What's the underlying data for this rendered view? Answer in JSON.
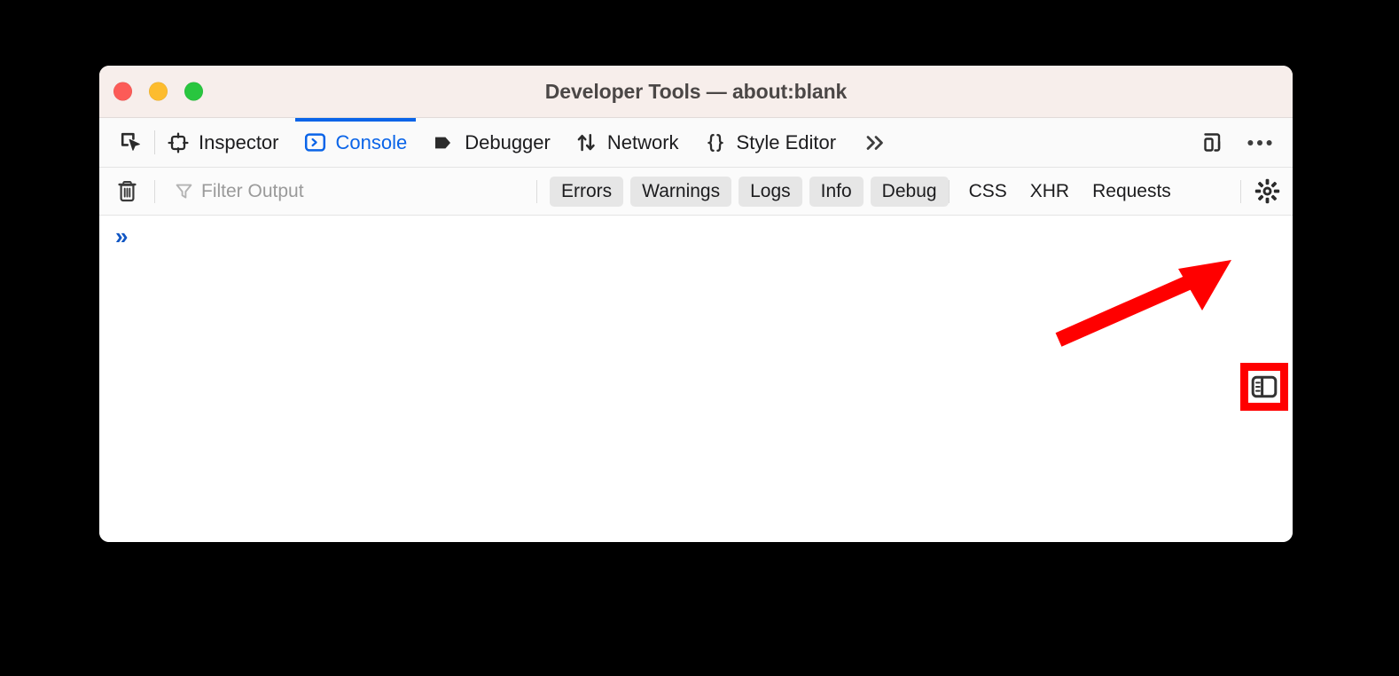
{
  "window": {
    "title": "Developer Tools — about:blank",
    "traffic_lights": [
      {
        "name": "close",
        "color": "#fc5b57"
      },
      {
        "name": "minimize",
        "color": "#fdbc2e"
      },
      {
        "name": "maximize",
        "color": "#29c63f"
      }
    ]
  },
  "toolbar": {
    "picker_icon": "element-picker-icon",
    "tabs": [
      {
        "label": "Inspector",
        "icon": "inspector-icon",
        "active": false
      },
      {
        "label": "Console",
        "icon": "console-icon",
        "active": true
      },
      {
        "label": "Debugger",
        "icon": "debugger-icon",
        "active": false
      },
      {
        "label": "Network",
        "icon": "network-icon",
        "active": false
      },
      {
        "label": "Style Editor",
        "icon": "style-editor-icon",
        "active": false
      }
    ],
    "overflow_label": "»",
    "responsive_mode_icon": "responsive-design-mode-icon",
    "meatball_menu_icon": "more-options-icon"
  },
  "filter_bar": {
    "clear_icon": "trash-icon",
    "filter_icon": "funnel-icon",
    "filter_value": "",
    "filter_placeholder": "Filter Output",
    "severity_pills": [
      "Errors",
      "Warnings",
      "Logs",
      "Info",
      "Debug"
    ],
    "type_filters": [
      "CSS",
      "XHR",
      "Requests"
    ],
    "settings_icon": "gear-icon"
  },
  "console": {
    "prompt_chevron": "»",
    "messages": []
  },
  "annotation": {
    "highlight_color": "#ff0000",
    "highlighted_control": "split-console-sidebar-toggle-icon",
    "arrow_color": "#ff0000"
  }
}
